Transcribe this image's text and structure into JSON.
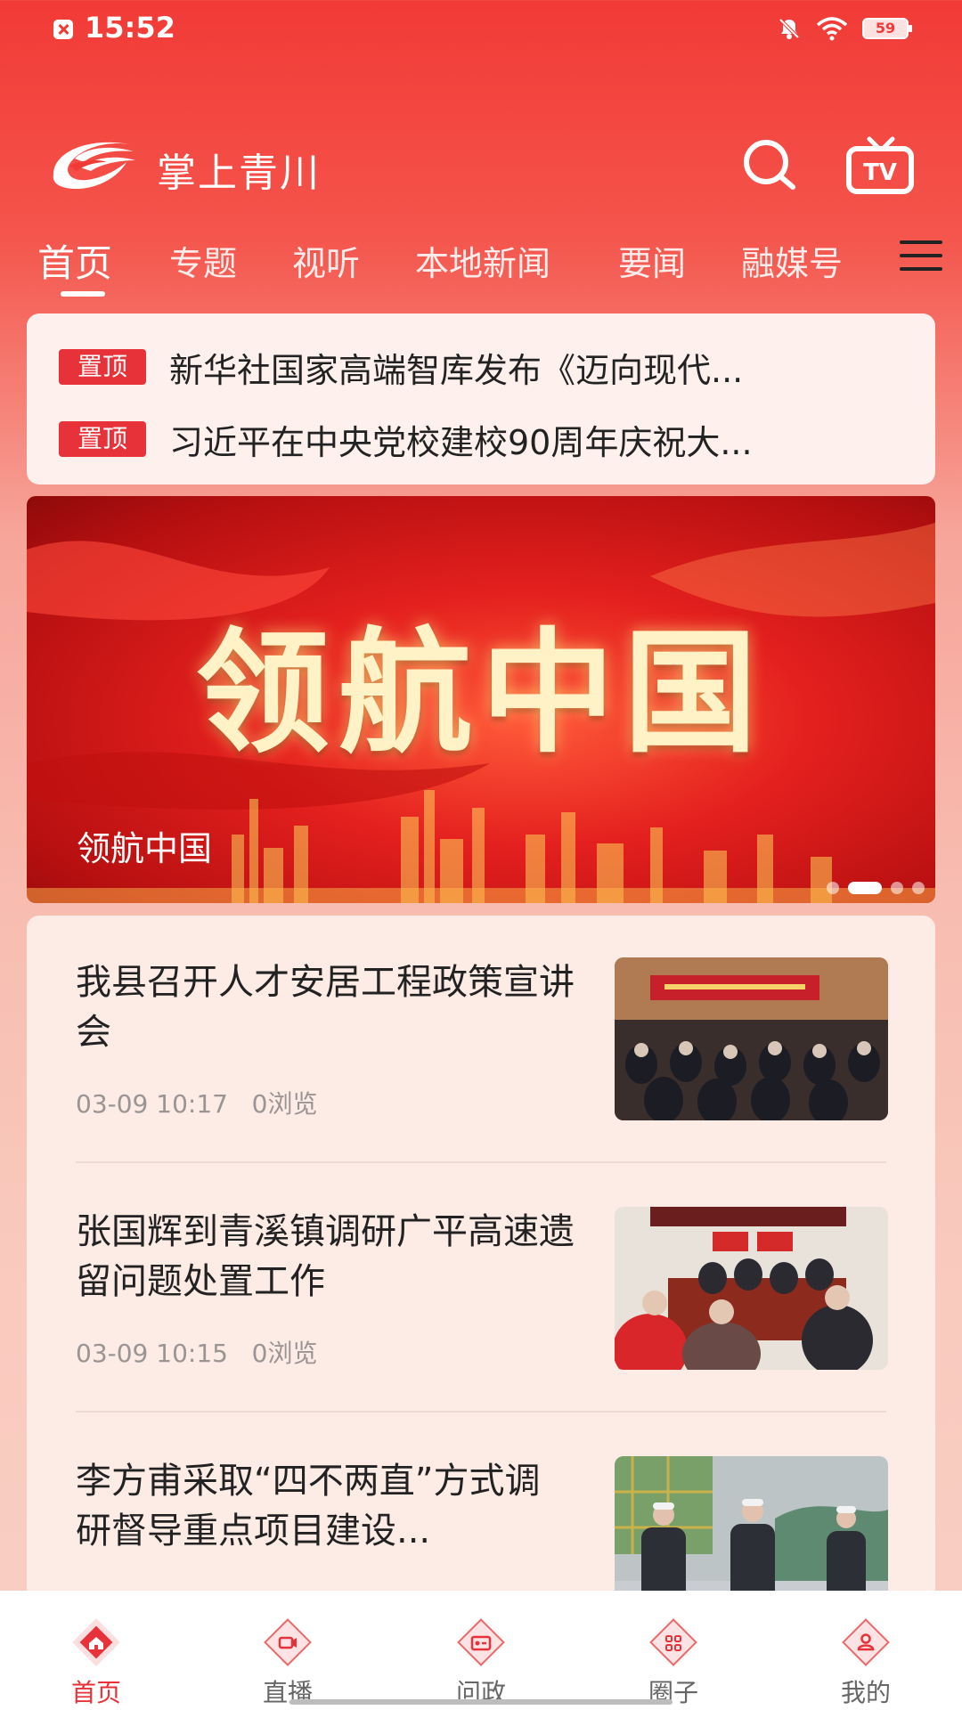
{
  "status_bar": {
    "time": "15:52",
    "battery": "59"
  },
  "header": {
    "app_title": "掌上青川"
  },
  "tabs": [
    {
      "label": "首页"
    },
    {
      "label": "专题"
    },
    {
      "label": "视听"
    },
    {
      "label": "本地新闻"
    },
    {
      "label": "要闻"
    },
    {
      "label": "融媒号"
    }
  ],
  "pinned": [
    {
      "badge": "置顶",
      "text": "新华社国家高端智库发布《迈向现代..."
    },
    {
      "badge": "置顶",
      "text": "习近平在中央党校建校90周年庆祝大..."
    }
  ],
  "banner": {
    "art_text": "领航中国",
    "caption": "领航中国",
    "dot_count": 4,
    "active_dot": 1
  },
  "news": [
    {
      "title": "我县召开人才安居工程政策宣讲会",
      "date": "03-09 10:17",
      "views": "0浏览"
    },
    {
      "title": "张国辉到青溪镇调研广平高速遗留问题处置工作",
      "date": "03-09 10:15",
      "views": "0浏览"
    },
    {
      "title": "李方甫采取“四不两直”方式调研督导重点项目建设...",
      "date": "",
      "views": ""
    }
  ],
  "bottom_nav": [
    {
      "label": "首页",
      "icon": "home-icon"
    },
    {
      "label": "直播",
      "icon": "live-camera-icon"
    },
    {
      "label": "问政",
      "icon": "id-card-icon"
    },
    {
      "label": "圈子",
      "icon": "grid-icon"
    },
    {
      "label": "我的",
      "icon": "user-icon"
    }
  ],
  "colors": {
    "accent": "#e8323a",
    "header_red": "#f23a36"
  }
}
